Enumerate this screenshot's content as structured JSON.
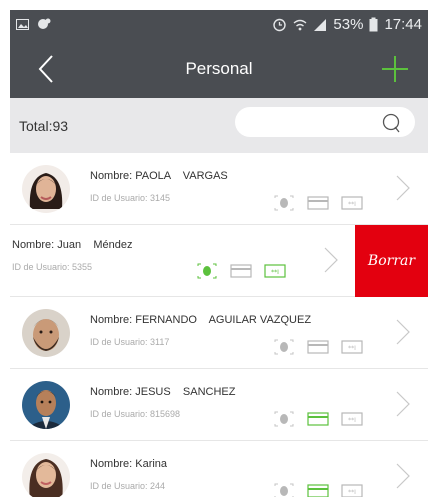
{
  "status": {
    "battery": "53%",
    "time": "17:44"
  },
  "header": {
    "title": "Personal"
  },
  "summary": {
    "total": "Total:93",
    "search_placeholder": ""
  },
  "users": [
    {
      "name": "Nombre: PAOLA    VARGAS",
      "id": "ID de Usuario: 3145",
      "icons_active": [
        "fingerprint"
      ],
      "swiped": false,
      "avatar": "woman-dark-hair"
    },
    {
      "name": "Nombre: Juan    Méndez",
      "id": "ID de Usuario: 5355",
      "icons_active": [
        "fingerprint",
        "card",
        "password"
      ],
      "swiped": true,
      "delete_label": "Borrar"
    },
    {
      "name": "Nombre: FERNANDO    AGUILAR VAZQUEZ",
      "id": "ID de Usuario: 3117",
      "icons_active": [
        "fingerprint"
      ],
      "swiped": false,
      "avatar": "man-beard"
    },
    {
      "name": "Nombre: JESUS    SANCHEZ",
      "id": "ID de Usuario: 815698",
      "icons_active": [
        "fingerprint",
        "card"
      ],
      "swiped": false,
      "avatar": "man-suit"
    },
    {
      "name": "Nombre: Karina",
      "id": "ID de Usuario: 244",
      "icons_active": [
        "fingerprint",
        "card"
      ],
      "swiped": false,
      "avatar": "woman-long-hair"
    }
  ],
  "colors": {
    "header_bg": "#4a4d52",
    "accent_green": "#5cc13d",
    "delete_red": "#e3000f",
    "inactive_icon": "#b8b8b8"
  }
}
